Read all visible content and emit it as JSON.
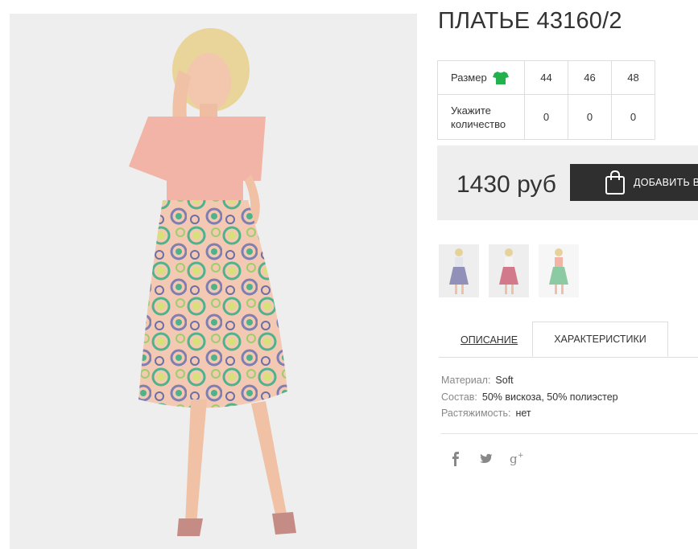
{
  "product": {
    "title": "ПЛАТЬЕ 43160/2",
    "price": "1430 руб",
    "add_to_cart_label": "ДОБАВИТЬ В"
  },
  "size_table": {
    "size_label": "Размер",
    "size_icon": "t-shirt-icon",
    "sizes": [
      "44",
      "46",
      "48"
    ],
    "quantity_label": "Укажите количество",
    "quantities": [
      "0",
      "0",
      "0"
    ]
  },
  "tabs": {
    "description": "ОПИСАНИЕ",
    "specs": "ХАРАКТЕРИСТИКИ",
    "active": "specs"
  },
  "specs": [
    {
      "key": "Материал:",
      "value": "Soft"
    },
    {
      "key": "Состав:",
      "value": "50% вискоза, 50% полиэстер"
    },
    {
      "key": "Растяжимость:",
      "value": "нет"
    }
  ],
  "social": [
    "facebook-icon",
    "twitter-icon",
    "google-plus-icon"
  ],
  "colors": {
    "accent_dark": "#2f2f2f",
    "size_icon_green": "#22b14c",
    "panel_gray": "#eeeeee"
  }
}
